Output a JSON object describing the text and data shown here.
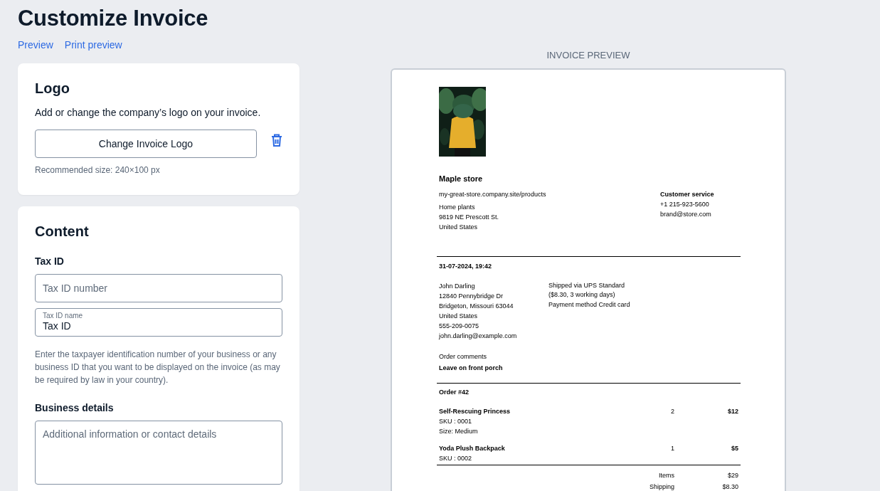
{
  "page": {
    "title": "Customize Invoice"
  },
  "links": [
    {
      "label": "Preview"
    },
    {
      "label": "Print preview"
    }
  ],
  "logo_card": {
    "title": "Logo",
    "description": "Add or change the company’s logo on your invoice.",
    "button": "Change Invoice Logo",
    "hint": "Recommended size: 240×100 px"
  },
  "content_card": {
    "title": "Content",
    "tax_id": {
      "label": "Tax ID",
      "number_field": {
        "placeholder": "Tax ID number"
      },
      "name_field": {
        "label": "Tax ID name",
        "value": "Tax ID"
      },
      "help": "Enter the taxpayer identification number of your business or any business ID that you want to be displayed on the invoice (as may be required by law in your country)."
    },
    "business_details": {
      "label": "Business details",
      "field": {
        "placeholder": "Additional information or contact details"
      }
    }
  },
  "preview": {
    "label": "INVOICE PREVIEW",
    "logo": {
      "kind": "picture"
    },
    "store_name": "Maple store",
    "store_lines": [
      "my-great-store.company.site/products",
      "Home plants",
      "9819 NE Prescott St.",
      "United States"
    ],
    "service": {
      "title": "Customer service",
      "lines": [
        "+1 215-923-5600",
        "brand@store.com"
      ]
    },
    "date": "31-07-2024, 19:42",
    "customer_lines": [
      "John Darling",
      "12840 Pennybridge Dr",
      "Bridgeton, Missouri 63044",
      "United States",
      "555-209-0075",
      "john.darling@example.com"
    ],
    "shipping_lines": [
      "Shipped via UPS Standard",
      "($8.30, 3 working days)",
      "Payment method Credit card"
    ],
    "comments_label": "Order comments",
    "comments": "Leave on front porch",
    "order_title": "Order #42",
    "items": [
      {
        "name": "Self-Rescuing Princess",
        "details": [
          "SKU : 0001",
          "Size: Medium"
        ],
        "quantity": "2",
        "price": "$12"
      },
      {
        "name": "Yoda Plush Backpack",
        "details": [
          "SKU : 0002"
        ],
        "quantity": "1",
        "price": "$5"
      }
    ],
    "totals": [
      {
        "label": "Items",
        "value": "$29"
      },
      {
        "label": "Shipping",
        "value": "$8.30"
      }
    ]
  }
}
